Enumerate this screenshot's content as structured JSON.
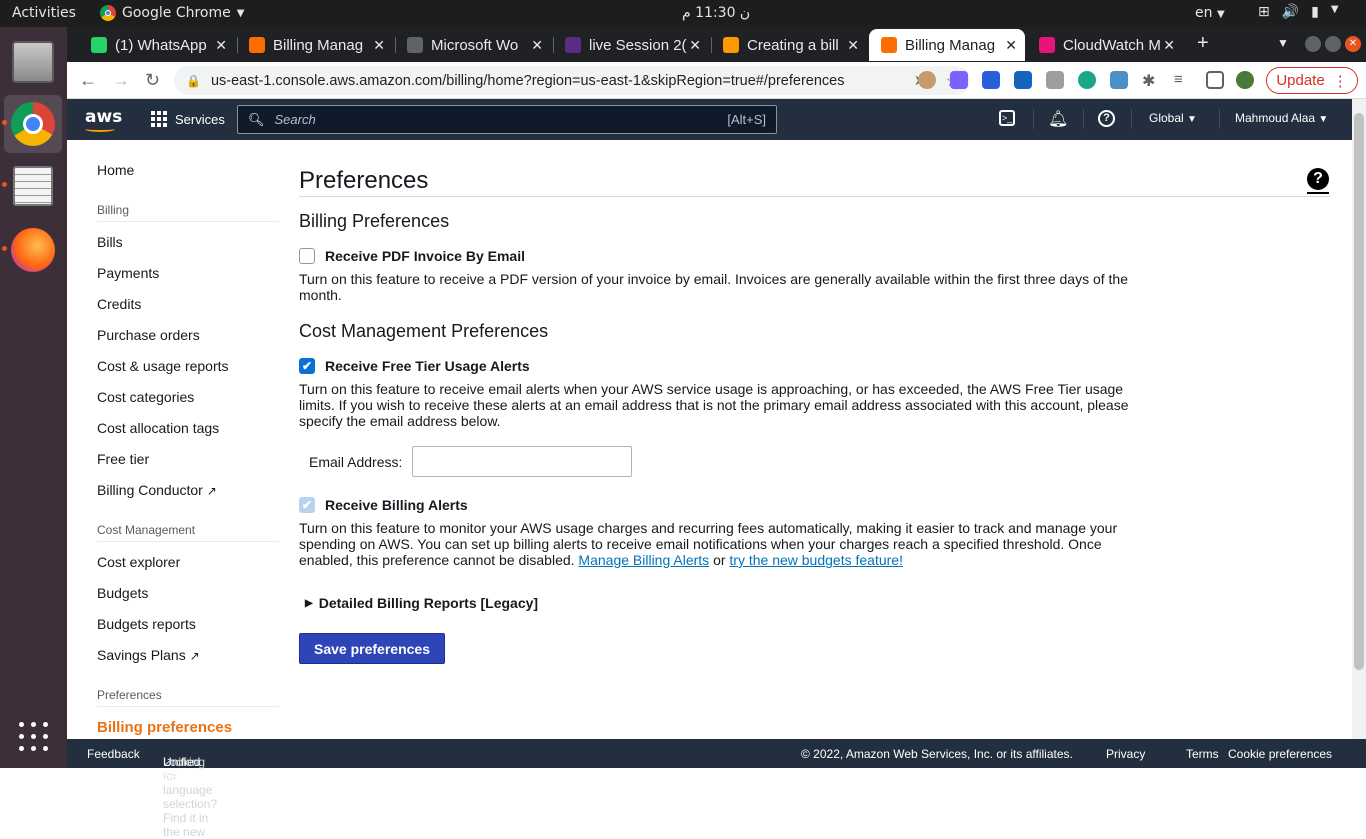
{
  "os": {
    "activities": "Activities",
    "app_name": "Google Chrome",
    "clock": "ن 11:30 م",
    "lang": "en"
  },
  "tabs": [
    {
      "title": "(1) WhatsApp",
      "color": "#25d366"
    },
    {
      "title": "Billing Manag",
      "color": "#ff6d00"
    },
    {
      "title": "Microsoft Wo",
      "color": "#5f6368"
    },
    {
      "title": "live Session 2(",
      "color": "#5a2d82"
    },
    {
      "title": "Creating a bill",
      "color": "#ff9900"
    },
    {
      "title": "Billing Manag",
      "color": "#ff6d00",
      "active": true
    },
    {
      "title": "CloudWatch M",
      "color": "#e7157b"
    }
  ],
  "browser": {
    "url": "us-east-1.console.aws.amazon.com/billing/home?region=us-east-1&skipRegion=true#/preferences",
    "update_label": "Update"
  },
  "awsnav": {
    "logo": "aws",
    "services": "Services",
    "search_placeholder": "Search",
    "search_hint": "[Alt+S]",
    "region": "Global",
    "user": "Mahmoud Alaa"
  },
  "sidebar": {
    "home": "Home",
    "billing_head": "Billing",
    "bills": "Bills",
    "payments": "Payments",
    "credits": "Credits",
    "purchase_orders": "Purchase orders",
    "cost_usage_reports": "Cost & usage reports",
    "cost_categories": "Cost categories",
    "cost_allocation_tags": "Cost allocation tags",
    "free_tier": "Free tier",
    "billing_conductor": "Billing Conductor",
    "cost_mgmt_head": "Cost Management",
    "cost_explorer": "Cost explorer",
    "budgets": "Budgets",
    "budgets_reports": "Budgets reports",
    "savings_plans": "Savings Plans",
    "preferences_head": "Preferences",
    "billing_preferences": "Billing preferences"
  },
  "main": {
    "title": "Preferences",
    "billing_prefs_title": "Billing Preferences",
    "pdf_label": "Receive PDF Invoice By Email",
    "pdf_checked": false,
    "pdf_desc": "Turn on this feature to receive a PDF version of your invoice by email. Invoices are generally available within the first three days of the month.",
    "cost_prefs_title": "Cost Management Preferences",
    "free_tier_label": "Receive Free Tier Usage Alerts",
    "free_tier_checked": true,
    "free_tier_desc": "Turn on this feature to receive email alerts when your AWS service usage is approaching, or has exceeded, the AWS Free Tier usage limits. If you wish to receive these alerts at an email address that is not the primary email address associated with this account, please specify the email address below.",
    "email_label": "Email Address:",
    "email_value": "",
    "billing_alerts_label": "Receive Billing Alerts",
    "billing_alerts_checked": true,
    "billing_alerts_desc": "Turn on this feature to monitor your AWS usage charges and recurring fees automatically, making it easier to track and manage your spending on AWS. You can set up billing alerts to receive email notifications when your charges reach a specified threshold. Once enabled, this preference cannot be disabled.",
    "manage_alerts_link": "Manage Billing Alerts",
    "or_text": "or",
    "budgets_link": "try the new budgets feature!",
    "legacy_reports": "Detailed Billing Reports [Legacy]",
    "save_button": "Save preferences"
  },
  "footer": {
    "feedback": "Feedback",
    "lang_text": "Looking for language selection? Find it in the new",
    "unified": "Unified Settings",
    "copyright": "© 2022, Amazon Web Services, Inc. or its affiliates.",
    "privacy": "Privacy",
    "terms": "Terms",
    "cookies": "Cookie preferences"
  }
}
